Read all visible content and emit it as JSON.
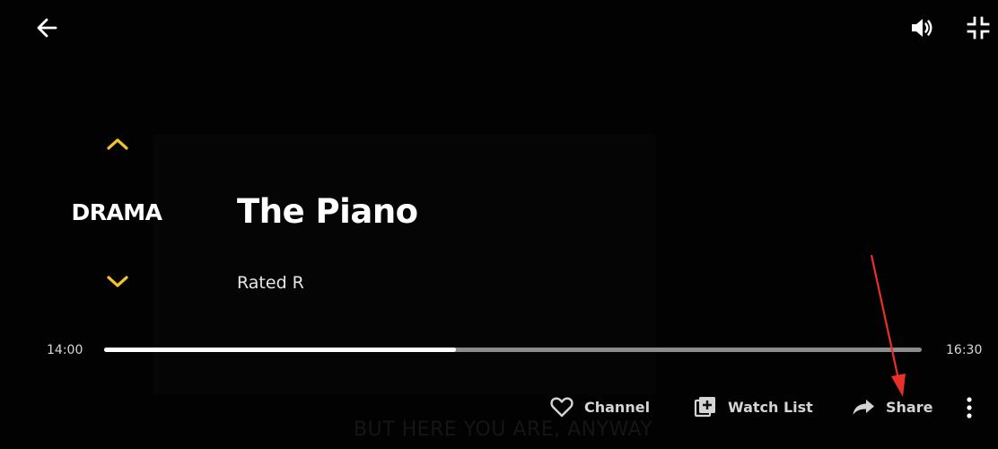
{
  "colors": {
    "background": "#020202",
    "accent_chevron": "#f2c230",
    "progress_fill": "#ffffff",
    "progress_track": "#8c8c8c",
    "annotation_arrow": "#e8302a"
  },
  "header": {
    "back_icon": "arrow-left-icon",
    "volume_icon": "volume-icon",
    "minimize_icon": "fullscreen-exit-icon"
  },
  "program": {
    "genre": "DRAMA",
    "title": "The Piano",
    "rating": "Rated R",
    "up_icon": "chevron-up-icon",
    "down_icon": "chevron-down-icon"
  },
  "timeline": {
    "start_time": "14:00",
    "end_time": "16:30",
    "progress": 0.43
  },
  "actions": {
    "channel_label": "Channel",
    "channel_icon": "heart-icon",
    "watchlist_label": "Watch List",
    "watchlist_icon": "add-to-list-icon",
    "share_label": "Share",
    "share_icon": "share-icon",
    "more_icon": "more-vertical-icon"
  },
  "subtitle_text": "BUT HERE YOU ARE, ANYWAY"
}
